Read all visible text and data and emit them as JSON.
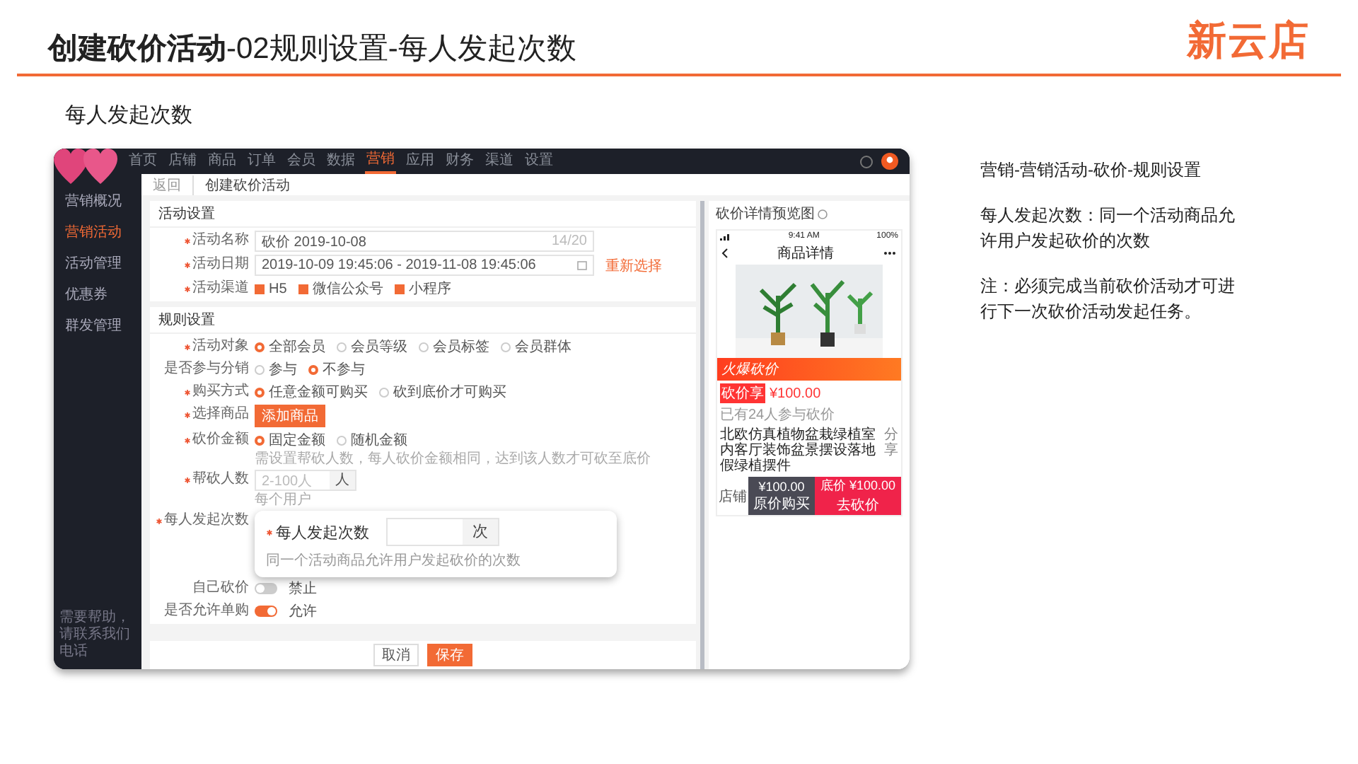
{
  "slide": {
    "title": "**创建砍价活动**-02规则设置-每人发起次数",
    "logo": "新云店",
    "subtitle": "每人发起次数"
  },
  "screenshot": {
    "top_nav": [
      {
        "label": "首页",
        "selected": false
      },
      {
        "label": "店铺",
        "selected": false
      },
      {
        "label": "商品",
        "selected": false
      },
      {
        "label": "订单",
        "selected": false
      },
      {
        "label": "会员",
        "selected": false
      },
      {
        "label": "数据",
        "selected": false
      },
      {
        "label": "营销",
        "selected": true
      },
      {
        "label": "应用",
        "selected": false
      },
      {
        "label": "财务",
        "selected": false
      },
      {
        "label": "渠道",
        "selected": false
      },
      {
        "label": "设置",
        "selected": false
      }
    ],
    "sidebar": {
      "items": [
        {
          "label": "营销概况",
          "selected": false
        },
        {
          "label": "营销活动",
          "selected": true
        },
        {
          "label": "活动管理",
          "selected": false
        },
        {
          "label": "优惠券",
          "selected": false
        },
        {
          "label": "群发管理",
          "selected": false
        }
      ],
      "help": "需要帮助，请联系我们电话"
    },
    "breadcrumb": {
      "back": "返回",
      "current": "创建砍价活动"
    },
    "sections": [
      {
        "title": "活动设置",
        "rows": [
          {
            "kind": "input",
            "label": "活动名称",
            "required": true,
            "value": "砍价 2019-10-08",
            "counter": "14/20"
          },
          {
            "kind": "daterange",
            "label": "活动日期",
            "required": true,
            "value": "2019-10-09 19:45:06 - 2019-11-08 19:45:06",
            "link": "重新选择"
          },
          {
            "kind": "checkboxes",
            "label": "活动渠道",
            "required": true,
            "options": [
              {
                "label": "H5",
                "checked": true
              },
              {
                "label": "微信公众号",
                "checked": true
              },
              {
                "label": "小程序",
                "checked": true
              }
            ]
          }
        ]
      },
      {
        "title": "规则设置",
        "rows": [
          {
            "kind": "radios",
            "label": "活动对象",
            "required": true,
            "options": [
              {
                "label": "全部会员",
                "selected": true
              },
              {
                "label": "会员等级",
                "selected": false
              },
              {
                "label": "会员标签",
                "selected": false
              },
              {
                "label": "会员群体",
                "selected": false
              }
            ]
          },
          {
            "kind": "radios",
            "label": "是否参与分销",
            "required": false,
            "options": [
              {
                "label": "参与",
                "selected": false
              },
              {
                "label": "不参与",
                "selected": true
              }
            ]
          },
          {
            "kind": "radios",
            "label": "购买方式",
            "required": true,
            "options": [
              {
                "label": "任意金额可购买",
                "selected": true
              },
              {
                "label": "砍到底价才可购买",
                "selected": false
              }
            ]
          },
          {
            "kind": "button",
            "label": "选择商品",
            "required": true,
            "button": "添加商品"
          },
          {
            "kind": "radios",
            "label": "砍价金额",
            "required": true,
            "options": [
              {
                "label": "固定金额",
                "selected": true
              },
              {
                "label": "随机金额",
                "selected": false
              }
            ],
            "hint": "需设置帮砍人数，每人砍价金额相同，达到该人数才可砍至底价"
          },
          {
            "kind": "suffix_input",
            "label": "帮砍人数",
            "required": true,
            "placeholder": "2-100人",
            "suffix": "人",
            "hint": "每个用户"
          },
          {
            "kind": "covered",
            "label": "每人发起次数",
            "required": true,
            "popup": {
              "label": "每人发起次数",
              "required": true,
              "suffix": "次",
              "hint": "同一个活动商品允许用户发起砍价的次数"
            }
          },
          {
            "kind": "toggle",
            "label": "自己砍价",
            "required": false,
            "on": false,
            "state_label": "禁止"
          },
          {
            "kind": "toggle",
            "label": "是否允许单购",
            "required": false,
            "on": true,
            "state_label": "允许"
          }
        ]
      }
    ],
    "footer_buttons": [
      {
        "label": "取消",
        "kind": "default"
      },
      {
        "label": "保存",
        "kind": "primary"
      }
    ],
    "preview": {
      "title": "砍价详情预览图",
      "phone": {
        "time": "9:41 AM",
        "battery": "100%",
        "header": "商品详情",
        "banner": "火爆砍价",
        "tag": "砍价享",
        "price": "¥100.00",
        "participants": "已有24人参与砍价",
        "product_title": "北欧仿真植物盆栽绿植室内客厅装饰盆景摆设落地假绿植摆件",
        "share": "分享",
        "shop": "店铺",
        "buy_price": "¥100.00",
        "buy_label": "原价购买",
        "bargain_price": "底价 ¥100.00",
        "bargain_label": "去砍价"
      }
    }
  },
  "notes": [
    "营销-营销活动-砍价-规则设置",
    "每人发起次数：同一个活动商品允许用户发起砍价的次数",
    "注：必须完成当前砍价活动才可进行下一次砍价活动发起任务。"
  ]
}
